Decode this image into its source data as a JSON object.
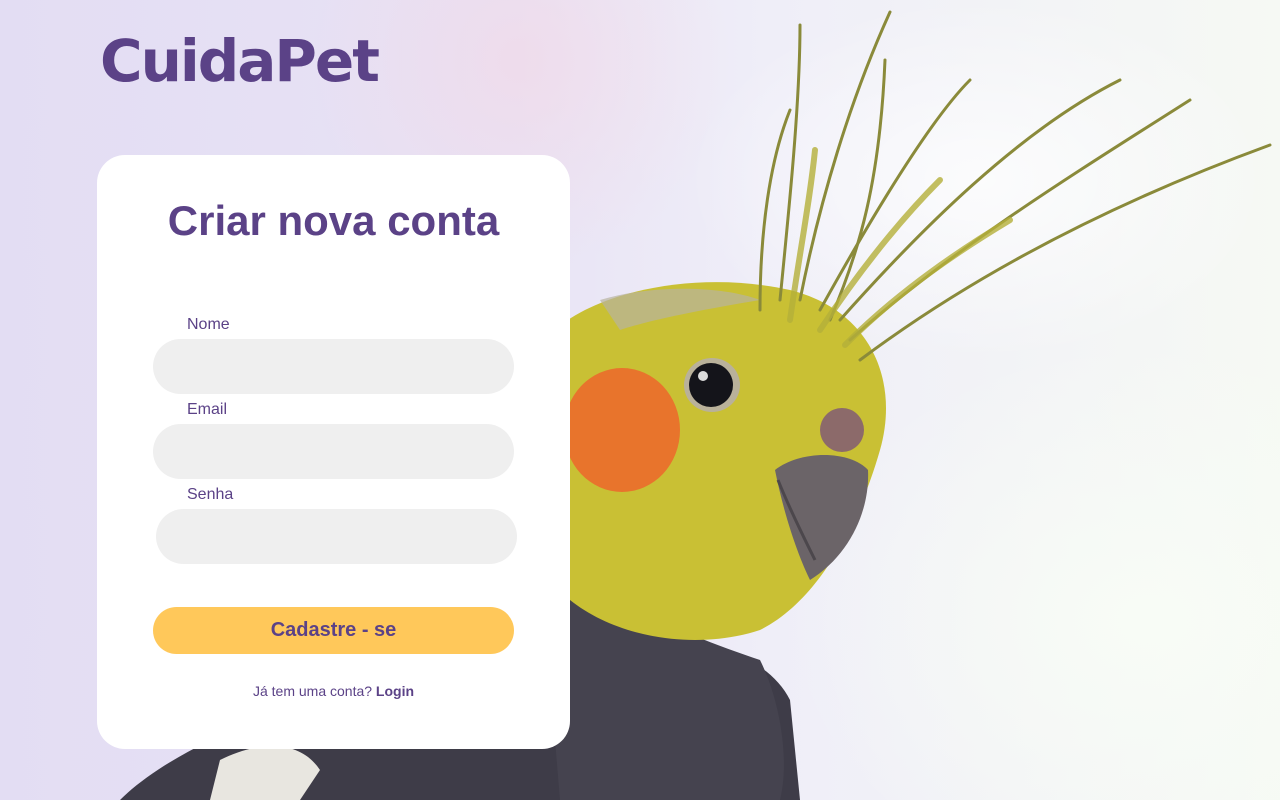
{
  "brand": {
    "logo_text": "CuidaPet"
  },
  "form": {
    "title": "Criar nova conta",
    "fields": [
      {
        "label": "Nome",
        "value": "",
        "placeholder": ""
      },
      {
        "label": "Email",
        "value": "",
        "placeholder": ""
      },
      {
        "label": "Senha",
        "value": "",
        "placeholder": ""
      }
    ],
    "submit_label": "Cadastre - se",
    "login_prompt": "Já tem uma conta?",
    "login_link": "Login"
  },
  "colors": {
    "brand_purple": "#5b4287",
    "button_yellow": "#ffc85a",
    "input_gray": "#efefef",
    "card_white": "#ffffff"
  },
  "icons": [
    "cockatiel-photo"
  ]
}
